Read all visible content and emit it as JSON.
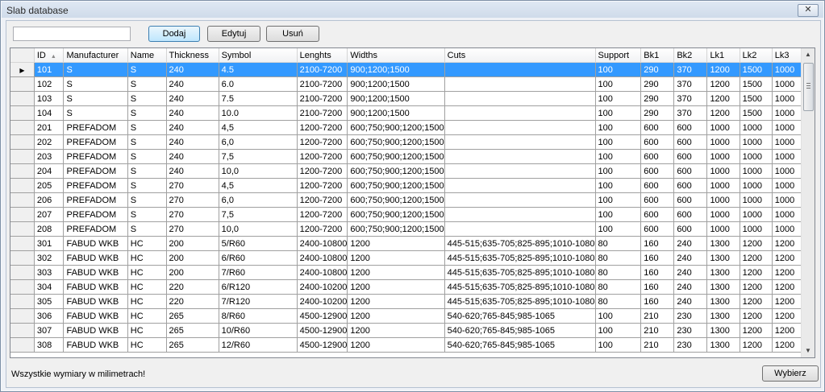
{
  "window": {
    "title": "Slab database",
    "close_glyph": "✕"
  },
  "toolbar": {
    "search_value": "",
    "add_label": "Dodaj",
    "edit_label": "Edytuj",
    "delete_label": "Usuń"
  },
  "grid": {
    "columns": [
      "ID",
      "Manufacturer",
      "Name",
      "Thickness",
      "Symbol",
      "Lenghts",
      "Widths",
      "Cuts",
      "Support",
      "Bk1",
      "Bk2",
      "Lk1",
      "Lk2",
      "Lk3"
    ],
    "sorted_column": "ID",
    "sort_icon": "sort-ascending-icon",
    "selected_row_index": 0,
    "selection_color": "#3399ff",
    "row_pointer_glyph": "▶",
    "rows": [
      [
        "101",
        "S",
        "S",
        "240",
        "4.5",
        "2100-7200",
        "900;1200;1500",
        "",
        "100",
        "290",
        "370",
        "1200",
        "1500",
        "1000"
      ],
      [
        "102",
        "S",
        "S",
        "240",
        "6.0",
        "2100-7200",
        "900;1200;1500",
        "",
        "100",
        "290",
        "370",
        "1200",
        "1500",
        "1000"
      ],
      [
        "103",
        "S",
        "S",
        "240",
        "7.5",
        "2100-7200",
        "900;1200;1500",
        "",
        "100",
        "290",
        "370",
        "1200",
        "1500",
        "1000"
      ],
      [
        "104",
        "S",
        "S",
        "240",
        "10.0",
        "2100-7200",
        "900;1200;1500",
        "",
        "100",
        "290",
        "370",
        "1200",
        "1500",
        "1000"
      ],
      [
        "201",
        "PREFADOM",
        "S",
        "240",
        "4,5",
        "1200-7200",
        "600;750;900;1200;1500",
        "",
        "100",
        "600",
        "600",
        "1000",
        "1000",
        "1000"
      ],
      [
        "202",
        "PREFADOM",
        "S",
        "240",
        "6,0",
        "1200-7200",
        "600;750;900;1200;1500",
        "",
        "100",
        "600",
        "600",
        "1000",
        "1000",
        "1000"
      ],
      [
        "203",
        "PREFADOM",
        "S",
        "240",
        "7,5",
        "1200-7200",
        "600;750;900;1200;1500",
        "",
        "100",
        "600",
        "600",
        "1000",
        "1000",
        "1000"
      ],
      [
        "204",
        "PREFADOM",
        "S",
        "240",
        "10,0",
        "1200-7200",
        "600;750;900;1200;1500",
        "",
        "100",
        "600",
        "600",
        "1000",
        "1000",
        "1000"
      ],
      [
        "205",
        "PREFADOM",
        "S",
        "270",
        "4,5",
        "1200-7200",
        "600;750;900;1200;1500",
        "",
        "100",
        "600",
        "600",
        "1000",
        "1000",
        "1000"
      ],
      [
        "206",
        "PREFADOM",
        "S",
        "270",
        "6,0",
        "1200-7200",
        "600;750;900;1200;1500",
        "",
        "100",
        "600",
        "600",
        "1000",
        "1000",
        "1000"
      ],
      [
        "207",
        "PREFADOM",
        "S",
        "270",
        "7,5",
        "1200-7200",
        "600;750;900;1200;1500",
        "",
        "100",
        "600",
        "600",
        "1000",
        "1000",
        "1000"
      ],
      [
        "208",
        "PREFADOM",
        "S",
        "270",
        "10,0",
        "1200-7200",
        "600;750;900;1200;1500",
        "",
        "100",
        "600",
        "600",
        "1000",
        "1000",
        "1000"
      ],
      [
        "301",
        "FABUD WKB",
        "HC",
        "200",
        "5/R60",
        "2400-10800",
        "1200",
        "445-515;635-705;825-895;1010-1080",
        "80",
        "160",
        "240",
        "1300",
        "1200",
        "1200"
      ],
      [
        "302",
        "FABUD WKB",
        "HC",
        "200",
        "6/R60",
        "2400-10800",
        "1200",
        "445-515;635-705;825-895;1010-1080",
        "80",
        "160",
        "240",
        "1300",
        "1200",
        "1200"
      ],
      [
        "303",
        "FABUD WKB",
        "HC",
        "200",
        "7/R60",
        "2400-10800",
        "1200",
        "445-515;635-705;825-895;1010-1080",
        "80",
        "160",
        "240",
        "1300",
        "1200",
        "1200"
      ],
      [
        "304",
        "FABUD WKB",
        "HC",
        "220",
        "6/R120",
        "2400-10200",
        "1200",
        "445-515;635-705;825-895;1010-1080",
        "80",
        "160",
        "240",
        "1300",
        "1200",
        "1200"
      ],
      [
        "305",
        "FABUD WKB",
        "HC",
        "220",
        "7/R120",
        "2400-10200",
        "1200",
        "445-515;635-705;825-895;1010-1080",
        "80",
        "160",
        "240",
        "1300",
        "1200",
        "1200"
      ],
      [
        "306",
        "FABUD WKB",
        "HC",
        "265",
        "8/R60",
        "4500-12900",
        "1200",
        "540-620;765-845;985-1065",
        "100",
        "210",
        "230",
        "1300",
        "1200",
        "1200"
      ],
      [
        "307",
        "FABUD WKB",
        "HC",
        "265",
        "10/R60",
        "4500-12900",
        "1200",
        "540-620;765-845;985-1065",
        "100",
        "210",
        "230",
        "1300",
        "1200",
        "1200"
      ],
      [
        "308",
        "FABUD WKB",
        "HC",
        "265",
        "12/R60",
        "4500-12900",
        "1200",
        "540-620;765-845;985-1065",
        "100",
        "210",
        "230",
        "1300",
        "1200",
        "1200"
      ]
    ]
  },
  "footer": {
    "note": "Wszystkie wymiary w milimetrach!",
    "select_label": "Wybierz"
  }
}
